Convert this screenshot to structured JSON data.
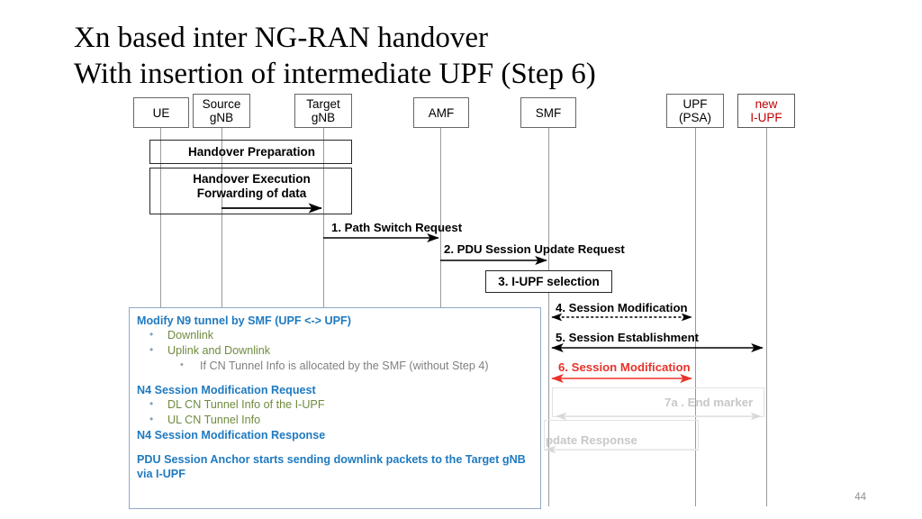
{
  "slide": {
    "title": "Xn based inter NG-RAN handover\nWith insertion of intermediate UPF (Step 6)",
    "page_number": "44",
    "colors": {
      "red_accent": "#e8332a",
      "actor_red": "#c00000",
      "note_heading_blue": "#1f7ac0",
      "note_bullet_green": "#6f8b3f",
      "note_sub_grey": "#808080",
      "faded_grey": "#c8c8c8",
      "lifeline_grey": "#9a9a9a",
      "box_border": "#262626"
    }
  },
  "actors": [
    {
      "id": "ue",
      "label": "UE",
      "red": false
    },
    {
      "id": "sgnb",
      "label": "Source\ngNB",
      "red": false
    },
    {
      "id": "tgnb",
      "label": "Target\ngNB",
      "red": false
    },
    {
      "id": "amf",
      "label": "AMF",
      "red": false
    },
    {
      "id": "smf",
      "label": "SMF",
      "red": false
    },
    {
      "id": "upfpsa",
      "label": "UPF\n(PSA)",
      "red": false
    },
    {
      "id": "iupf",
      "label": "new\nI-UPF",
      "red": true
    }
  ],
  "phases": [
    {
      "id": "handover-preparation",
      "label": "Handover Preparation"
    },
    {
      "id": "handover-execution",
      "label": "Handover Execution\nForwarding of data"
    }
  ],
  "messages": [
    {
      "id": "step1",
      "label": "1. Path Switch Request",
      "style": "solid",
      "color": "black",
      "direction": "right"
    },
    {
      "id": "step2",
      "label": "2. PDU Session Update Request",
      "style": "solid",
      "color": "black",
      "direction": "right"
    },
    {
      "id": "step4",
      "label": "4. Session Modification",
      "style": "dashed",
      "color": "black",
      "direction": "both"
    },
    {
      "id": "step5",
      "label": "5. Session Establishment",
      "style": "solid",
      "color": "black",
      "direction": "both"
    },
    {
      "id": "step6",
      "label": "6. Session Modification",
      "style": "solid",
      "color": "red",
      "direction": "both"
    },
    {
      "id": "step7a",
      "label": "7a . End marker",
      "style": "solid",
      "color": "faded",
      "direction": "both"
    },
    {
      "id": "step-update-response",
      "label": "PDU Session Update Response",
      "visible_text": "pdate Response",
      "style": "solid",
      "color": "faded",
      "direction": "left"
    }
  ],
  "step_boxes": [
    {
      "id": "step3",
      "label": "3. I-UPF selection"
    }
  ],
  "note": {
    "lines": [
      {
        "type": "heading",
        "text": "Modify N9 tunnel by SMF (UPF <-> UPF)"
      },
      {
        "type": "bullet",
        "text": "Downlink"
      },
      {
        "type": "bullet",
        "text": "Uplink and Downlink"
      },
      {
        "type": "sub",
        "text": "If  CN Tunnel Info is allocated by the SMF (without Step 4)"
      },
      {
        "type": "gap",
        "text": ""
      },
      {
        "type": "heading",
        "text": "N4 Session Modification Request"
      },
      {
        "type": "bullet",
        "text": "DL CN Tunnel Info of the I-UPF"
      },
      {
        "type": "bullet",
        "text": "UL CN Tunnel Info"
      },
      {
        "type": "heading",
        "text": "N4 Session Modification Response"
      },
      {
        "type": "gap2",
        "text": ""
      },
      {
        "type": "heading",
        "text": "PDU Session Anchor starts sending downlink packets to the Target gNB"
      },
      {
        "type": "heading",
        "text": "via I-UPF"
      }
    ]
  }
}
